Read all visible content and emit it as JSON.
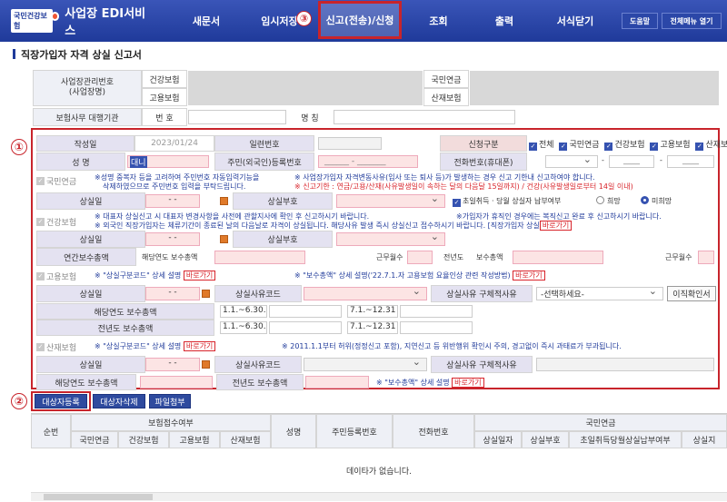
{
  "topbar": {
    "logo_badge": "국민건강보험",
    "logo_text": "사업장 EDI서비스",
    "menu": [
      "새문서",
      "임시저장",
      "신고(전송)/신청",
      "조회",
      "출력",
      "서식닫기"
    ],
    "right_buttons": [
      "도움말",
      "전체메뉴 열기"
    ],
    "step3_marker": "③"
  },
  "page_title": "직장가입자 자격 상실 신고서",
  "business": {
    "reg_label": "사업장관리번호\n(사업장명)",
    "health": "건강보험",
    "employment": "고용보험",
    "pension": "국민연금",
    "accident": "산재보험",
    "agency_label": "보험사무 대행기관",
    "number_label": "번 호",
    "name_label": "명 칭"
  },
  "form": {
    "marker": "①",
    "write_date_label": "작성일",
    "write_date": "2023/01/24",
    "serial_label": "일련번호",
    "apply_type_label": "신청구분",
    "apply_types": [
      "전체",
      "국민연금",
      "건강보험",
      "고용보험",
      "산재보험"
    ],
    "name_label": "성 명",
    "name_value": "대니",
    "id_label": "주민(외국인)등록번호",
    "id_placeholder": "______ - _______",
    "phone_label": "전화번호(휴대폰)",
    "phone_sep": "-",
    "phone_dash": "____",
    "pension_tag": "국민연금",
    "pension_note1": "※성명 중복자 등을 고려하여 주민번호 자동입력기능을",
    "pension_note1b": "삭제하였으므로 주민번호 입력을 부탁드립니다.",
    "pension_note2": "※ 사업장가입자 자격변동사유(입사 또는 퇴사 등)가 발생하는 경우 신고 기한내 신고하여야 합니다.",
    "pension_note3": "※ 신고기한 : 연금/고용/산재(사유발생일이 속하는 달의 다음달 15일까지) / 건강(사유발생일로부터 14일 이내)",
    "loss_date_label": "상실일",
    "loss_date_value": "- -",
    "loss_code_label": "상실부호",
    "first_pay_label": "초일취득 · 당월 상실자 납부여부",
    "hope": "희망",
    "no_hope": "미희망",
    "health_tag": "건강보험",
    "health_note1": "※ 대표자 상실신고 시 대표자 변경사항을 사전에 관할지사에 확인 후 신고하시기 바랍니다.",
    "health_note2": "※ 외국인 직장가입자는 체류기간이 종료된 날의 다음날로 자격이 상실됩니다. 해당사유 발생 즉시 상실신고 접수하시기 바랍니다. [직장가입자 상실",
    "health_note3": "※가입자가 휴직인 경우에는 복직신고 완료 후 신고하시기 바랍니다.",
    "shortcut": "바로가기",
    "annual_pay_label": "연간보수총액",
    "this_year_pay": "해당연도 보수총액",
    "work_months": "근무월수",
    "last_year": "전년도",
    "pay_total": "보수총액",
    "employment_tag": "고용보험",
    "emp_note1": "※ \"상실구분코드\" 상세 설명",
    "emp_note2": "※ \"보수총액\" 상세 설명('22.7.1.자 고용보험 요율인상 관련 작성방법)",
    "loss_reason_code": "상실사유코드",
    "loss_reason_detail": "상실사유 구체적사유",
    "select_placeholder": "-선택하세요-",
    "leave_confirm": "이직확인서",
    "this_year_pay_label": "해당연도 보수총액",
    "last_year_pay_label": "전년도 보수총액",
    "period1": "1.1.~6.30.",
    "period2": "7.1.~12.31",
    "accident_tag": "산재보험",
    "acc_note1": "※ \"상실구분코드\" 상세 설명",
    "acc_note2": "※ 2011.1.1부터 허위(정정신고 포함), 지연신고 등 위반행위 확인시 주의, 경고없이 즉시 과태료가 부과됩니다.",
    "acc_note3": "※ \"보수총액\" 상세 설명"
  },
  "actions": {
    "marker": "②",
    "register": "대상자등록",
    "delete": "대상자삭제",
    "attach": "파일첨부"
  },
  "grid": {
    "seq": "순번",
    "insurance_group": "보험접수여부",
    "ins_cols": [
      "국민연금",
      "건강보험",
      "고용보험",
      "산재보험"
    ],
    "name": "성명",
    "id": "주민등록번호",
    "phone": "전화번호",
    "pension_group": "국민연금",
    "pension_cols": [
      "상실일자",
      "상실부호",
      "초일취득당월상실납부여부",
      "상실지"
    ],
    "empty": "데이타가 없습니다."
  }
}
